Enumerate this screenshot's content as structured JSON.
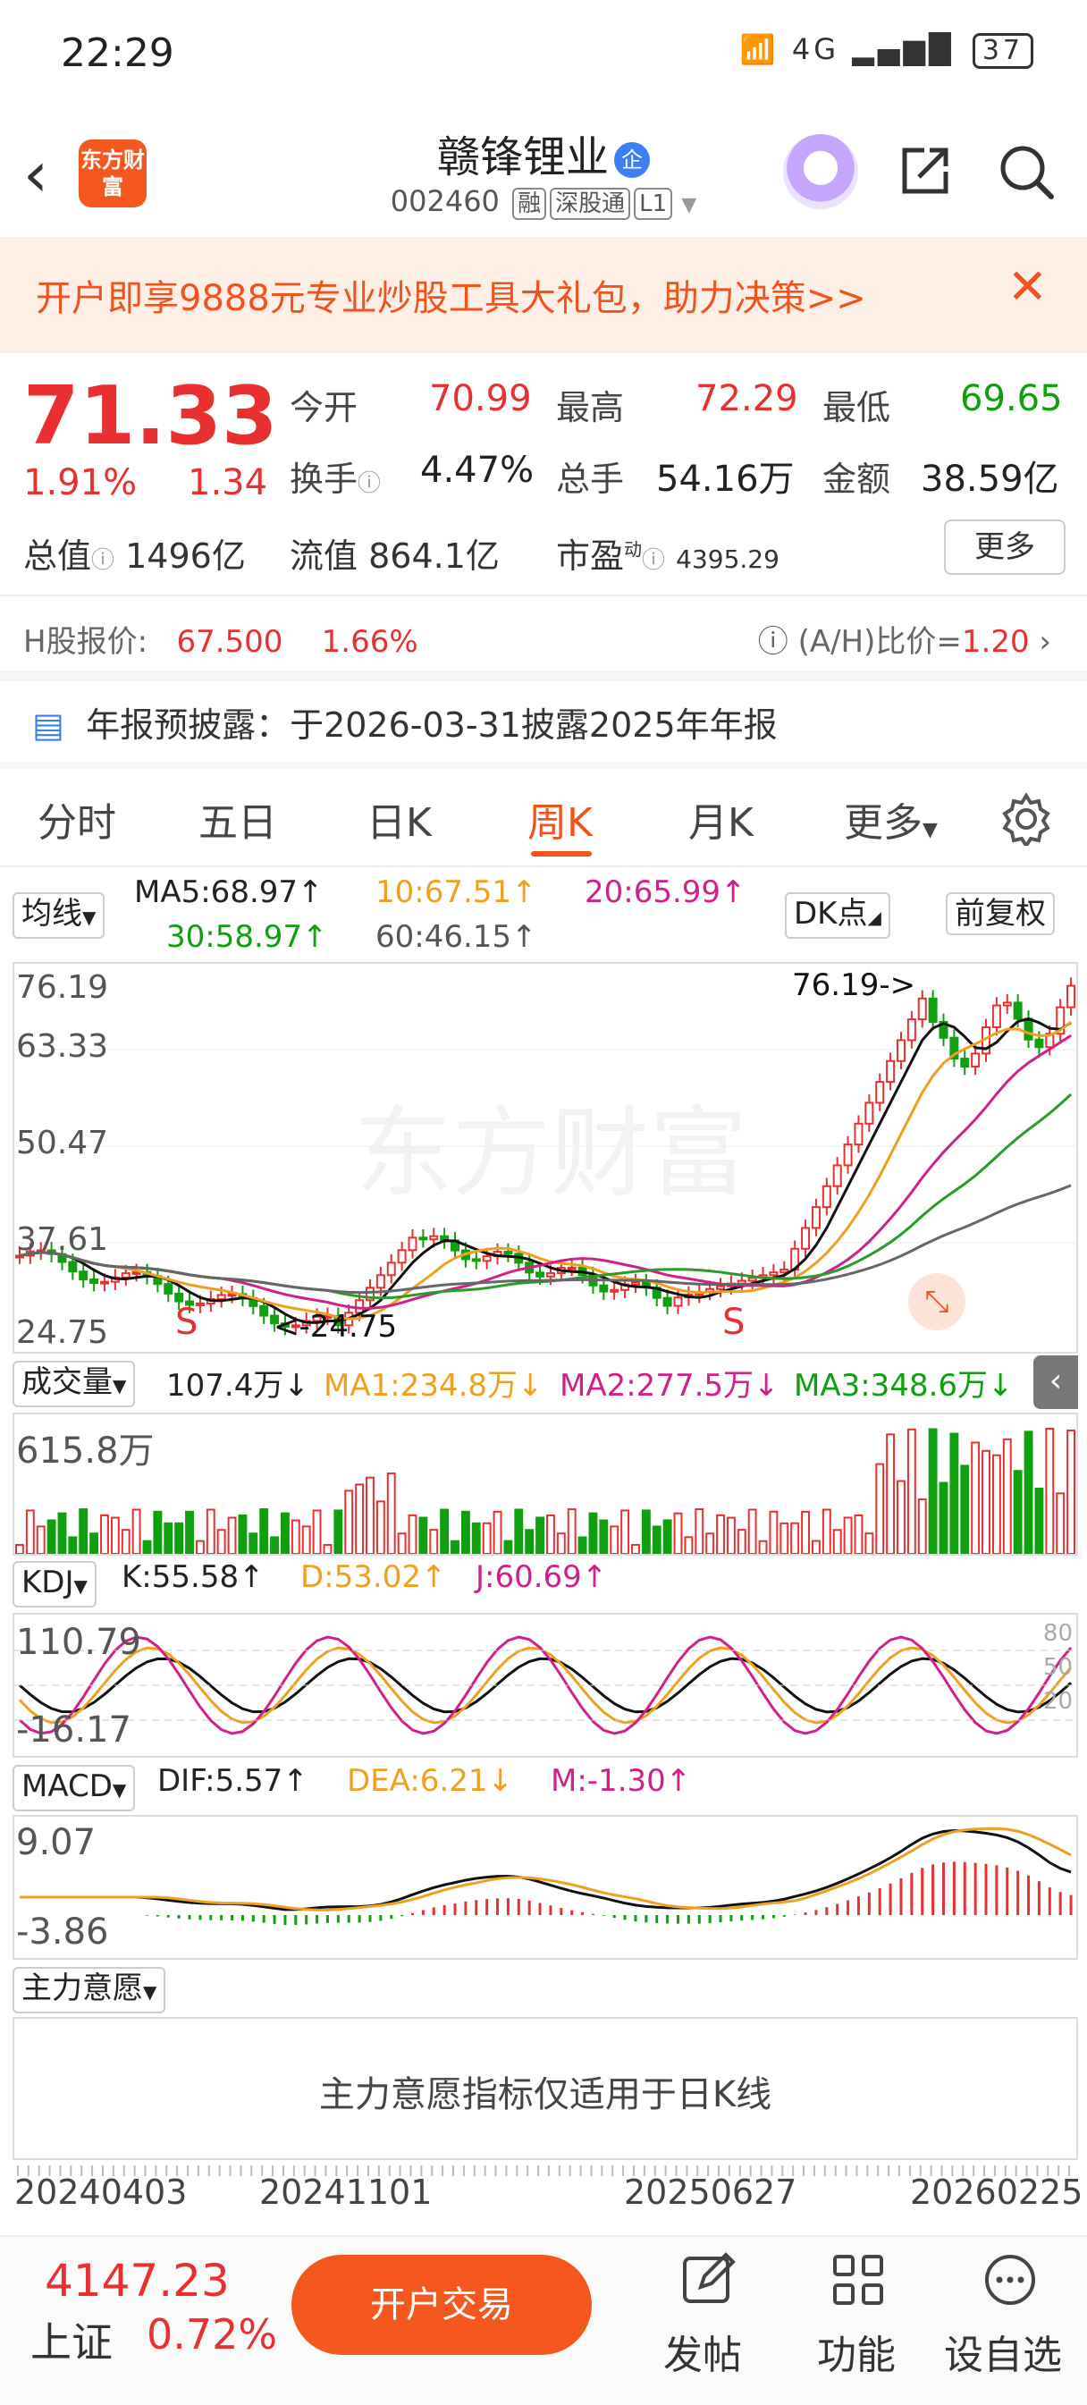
{
  "status_bar": {
    "time": "22:29",
    "network": "4G",
    "battery": "37"
  },
  "header": {
    "logo_text": "东方财富",
    "title": "赣锋锂业",
    "cert_badge": "企",
    "code": "002460",
    "tags": [
      "融",
      "深股通",
      "L1"
    ]
  },
  "banner": {
    "text": "开户即享9888元专业炒股工具大礼包，助力决策>>"
  },
  "quote": {
    "price": "71.33",
    "pct": "1.91%",
    "change": "1.34",
    "fields": [
      {
        "label": "今开",
        "value": "70.99",
        "color": "red"
      },
      {
        "label": "最高",
        "value": "72.29",
        "color": "red"
      },
      {
        "label": "最低",
        "value": "69.65",
        "color": "green"
      },
      {
        "label": "换手",
        "value": "4.47%",
        "color": "black"
      },
      {
        "label": "总手",
        "value": "54.16万",
        "color": "black"
      },
      {
        "label": "金额",
        "value": "38.59亿",
        "color": "black"
      }
    ],
    "total_value_label": "总值",
    "total_value": "1496亿",
    "float_value_label": "流值",
    "float_value": "864.1亿",
    "pe_label": "市盈",
    "pe_sup": "动",
    "pe_value": "4395.29",
    "more_label": "更多"
  },
  "h_share": {
    "label": "H股报价:",
    "price": "67.500",
    "pct": "1.66%",
    "ratio_label": "(A/H)比价=",
    "ratio": "1.20"
  },
  "annual": {
    "text": "年报预披露：于2026-03-31披露2025年年报"
  },
  "tabs": [
    "分时",
    "五日",
    "日K",
    "周K",
    "月K",
    "更多"
  ],
  "active_tab": "周K",
  "ma": {
    "selector": "均线",
    "ma5": "MA5:68.97↑",
    "ma10": "10:67.51↑",
    "ma20": "20:65.99↑",
    "ma30": "30:58.97↑",
    "ma60": "60:46.15↑",
    "dk": "DK点",
    "adjust": "前复权"
  },
  "kline": {
    "yticks": [
      "76.19",
      "63.33",
      "50.47",
      "37.61",
      "24.75"
    ],
    "max_label": "76.19->",
    "min_label": "<-24.75",
    "watermark": "东方财富",
    "signals": [
      "S",
      "S"
    ]
  },
  "volume": {
    "selector": "成交量",
    "value": "107.4万↓",
    "ma1": "MA1:234.8万↓",
    "ma2": "MA2:277.5万↓",
    "ma3": "MA3:348.6万↓",
    "ytick": "615.8万"
  },
  "kdj": {
    "selector": "KDJ",
    "k": "K:55.58↑",
    "d": "D:53.02↑",
    "j": "J:60.69↑",
    "ytop": "110.79",
    "ybot": "-16.17",
    "levels": [
      "80",
      "50",
      "20"
    ]
  },
  "macd": {
    "selector": "MACD",
    "dif": "DIF:5.57↑",
    "dea": "DEA:6.21↓",
    "m": "M:-1.30↑",
    "ytop": "9.07",
    "ybot": "-3.86"
  },
  "main_force": {
    "selector": "主力意愿",
    "note": "主力意愿指标仅适用于日K线"
  },
  "dates": [
    "20240403",
    "20241101",
    "20250627",
    "20260225"
  ],
  "bottom": {
    "index_value": "4147.23",
    "index_name": "上证",
    "index_pct": "0.72%",
    "trade_label": "开户交易",
    "post_label": "发帖",
    "func_label": "功能",
    "custom_label": "设自选"
  },
  "colors": {
    "accent": "#f4581f",
    "up": "#e93030",
    "down": "#0f9f0f",
    "ma10": "#f0a020",
    "ma20": "#d0208a",
    "ma30": "#2a9a2a"
  }
}
